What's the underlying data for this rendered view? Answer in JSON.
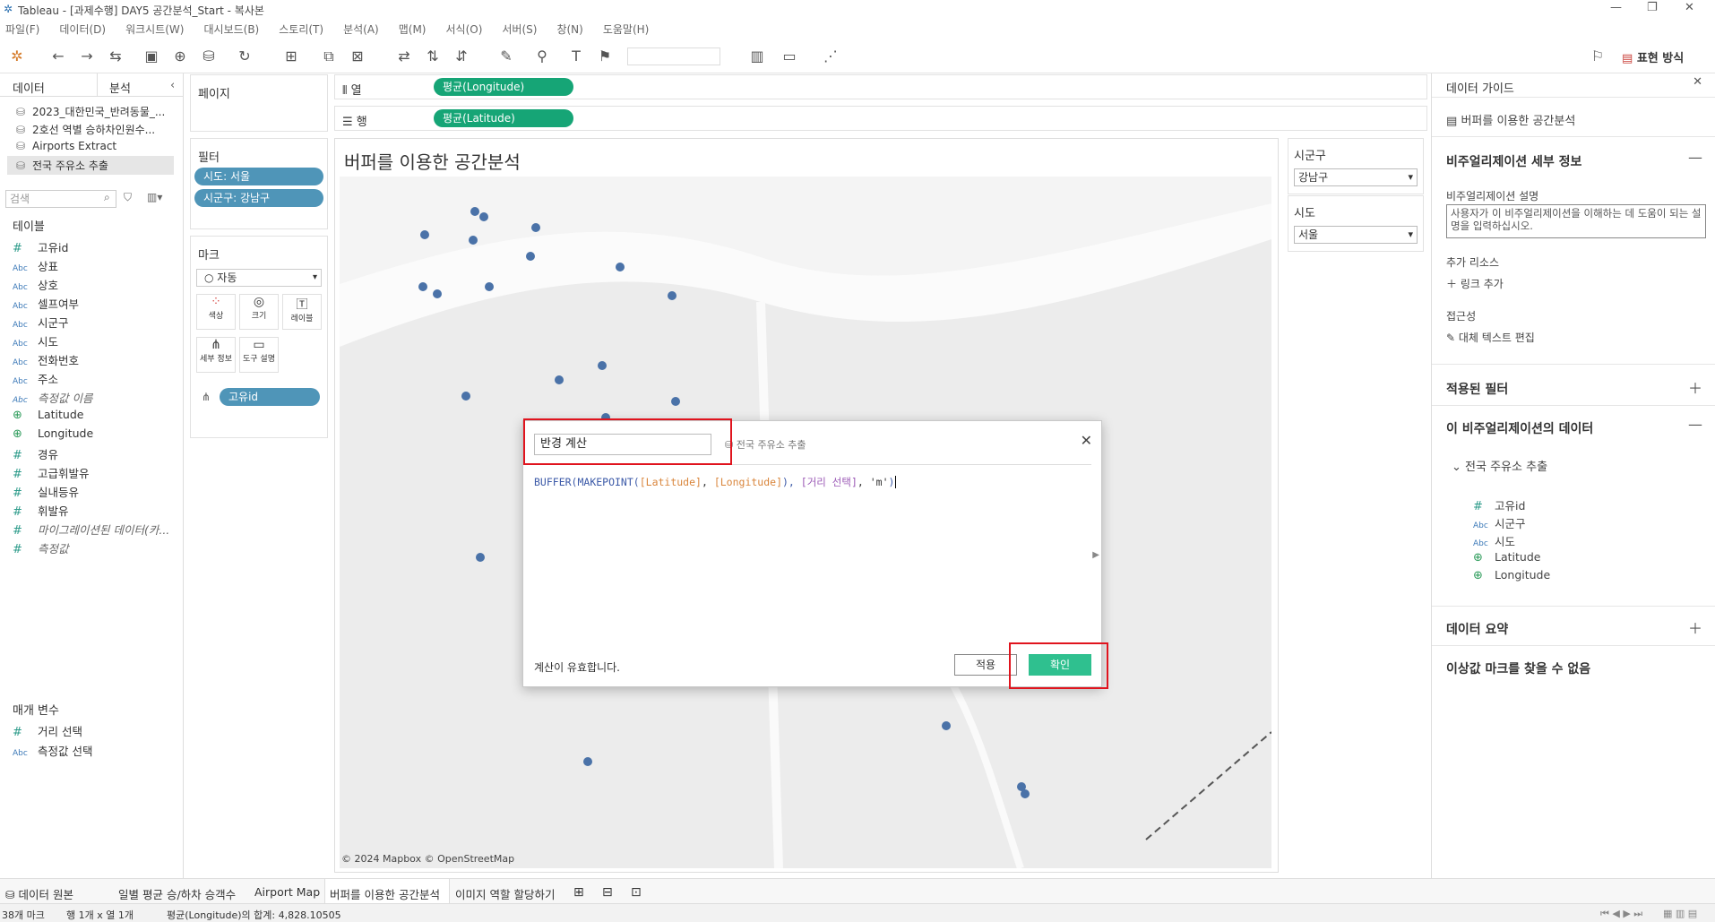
{
  "window": {
    "title": "Tableau - [과제수행] DAY5 공간분석_Start - 복사본"
  },
  "menu": [
    "파일(F)",
    "데이터(D)",
    "워크시트(W)",
    "대시보드(B)",
    "스토리(T)",
    "분석(A)",
    "맵(M)",
    "서식(O)",
    "서버(S)",
    "창(N)",
    "도움말(H)"
  ],
  "toolbar": {
    "show_me_label": "표현 방식"
  },
  "left_panel": {
    "tab_data": "데이터",
    "tab_analysis": "분석",
    "sources": [
      "2023_대한민국_반려동물_...",
      "2호선 역별 승하차인원수...",
      "Airports Extract",
      "전국 주유소 추출"
    ],
    "search_placeholder": "검색",
    "tables_header": "테이블",
    "fields": [
      {
        "type": "#",
        "name": "고유id"
      },
      {
        "type": "Abc",
        "name": "상표"
      },
      {
        "type": "Abc",
        "name": "상호"
      },
      {
        "type": "Abc",
        "name": "셀프여부"
      },
      {
        "type": "Abc",
        "name": "시군구"
      },
      {
        "type": "Abc",
        "name": "시도"
      },
      {
        "type": "Abc",
        "name": "전화번호"
      },
      {
        "type": "Abc",
        "name": "주소"
      },
      {
        "type": "Abc",
        "name": "측정값 이름",
        "italic": true
      },
      {
        "type": "geo",
        "name": "Latitude"
      },
      {
        "type": "geo",
        "name": "Longitude"
      },
      {
        "type": "#",
        "name": "경유"
      },
      {
        "type": "#",
        "name": "고급휘발유"
      },
      {
        "type": "#",
        "name": "실내등유"
      },
      {
        "type": "#",
        "name": "휘발유"
      },
      {
        "type": "#",
        "name": "마이그레이션된 데이터(카...",
        "italic": true
      },
      {
        "type": "#",
        "name": "측정값",
        "italic": true
      }
    ],
    "params_header": "매개 변수",
    "params": [
      {
        "type": "#",
        "name": "거리 선택"
      },
      {
        "type": "Abc",
        "name": "측정값 선택"
      }
    ]
  },
  "pages": {
    "header": "페이지"
  },
  "filters": {
    "header": "필터",
    "pills": [
      "시도: 서울",
      "시군구: 강남구"
    ]
  },
  "marks": {
    "header": "마크",
    "type": "자동",
    "buttons": [
      "색상",
      "크기",
      "레이블",
      "세부 정보",
      "도구 설명"
    ],
    "detail_pill": "고유id"
  },
  "shelves": {
    "columns_label": "열",
    "columns_pill": "평균(Longitude)",
    "rows_label": "행",
    "rows_pill": "평균(Latitude)"
  },
  "viz": {
    "title": "버퍼를 이용한 공간분석",
    "attribution": "© 2024 Mapbox © OpenStreetMap"
  },
  "filter_cards": [
    {
      "title": "시군구",
      "value": "강남구"
    },
    {
      "title": "시도",
      "value": "서울"
    }
  ],
  "dialog": {
    "calc_name": "반경 계산",
    "datasource": "전국 주유소 추출",
    "formula": {
      "fn1": "BUFFER(",
      "fn2": "MAKEPOINT(",
      "f1": "[Latitude]",
      "sep1": ", ",
      "f2": "[Longitude]",
      "close1": "), ",
      "p1": "[거리 선택]",
      "sep2": ", ",
      "s1": "'m'",
      "close2": ")"
    },
    "status": "계산이 유효합니다.",
    "apply": "적용",
    "ok": "확인"
  },
  "guide": {
    "title": "데이터 가이드",
    "sheet_name": "버퍼를 이용한 공간분석",
    "viz_details": "비주얼리제이션 세부 정보",
    "viz_desc_label": "비주얼리제이션 설명",
    "viz_desc_placeholder": "사용자가 이 비주얼리제이션을 이해하는 데 도움이 되는 설명을 입력하십시오.",
    "extra_resources": "추가 리소스",
    "add_link": "링크 추가",
    "accessibility": "접근성",
    "alt_text": "대체 텍스트 편집",
    "applied_filters": "적용된 필터",
    "viz_data": "이 비주얼리제이션의 데이터",
    "datasource": "전국 주유소 추출",
    "fields": [
      {
        "type": "#",
        "name": "고유id"
      },
      {
        "type": "Abc",
        "name": "시군구"
      },
      {
        "type": "Abc",
        "name": "시도"
      },
      {
        "type": "geo",
        "name": "Latitude"
      },
      {
        "type": "geo",
        "name": "Longitude"
      }
    ],
    "data_summary": "데이터 요약",
    "outliers": "이상값 마크를 찾을 수 없음"
  },
  "bottom_tabs": [
    "데이터 원본",
    "일별 평균 승/하차 승객수",
    "Airport Map",
    "버퍼를 이용한 공간분석",
    "이미지 역할 할당하기"
  ],
  "status": {
    "marks": "38개 마크",
    "rowcol": "행 1개 x 열 1개",
    "sum": "평균(Longitude)의 합계: 4,828.10505"
  },
  "colors": {
    "accent": "#16a576",
    "pill_blue": "#4f95b8",
    "dot": "#4a72a8",
    "highlight": "#e0141e"
  }
}
